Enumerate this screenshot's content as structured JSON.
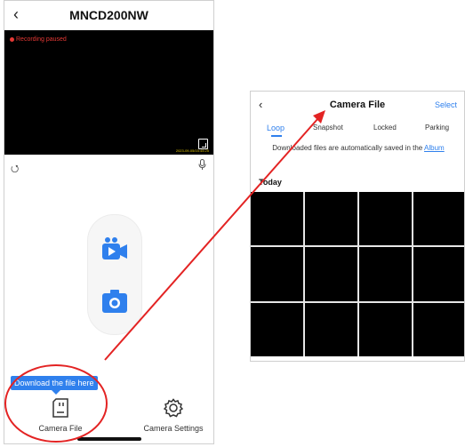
{
  "left_screen": {
    "title": "MNCD200NW",
    "back_icon": "chevron-left-icon",
    "recording_status": "Recording paused",
    "video_timestamp": "2023-09-05/15:45:25",
    "tooltip": "Download the file here",
    "tabs": [
      {
        "label": "Camera File",
        "icon": "sd-card-icon"
      },
      {
        "label": "Camera Settings",
        "icon": "gear-icon"
      }
    ]
  },
  "right_screen": {
    "title": "Camera File",
    "select_label": "Select",
    "tabs": [
      "Loop",
      "Snapshot",
      "Locked",
      "Parking"
    ],
    "active_tab": "Loop",
    "notice_prefix": "Downloaded files are automatically saved in the",
    "notice_link": "Album",
    "section_label": "Today",
    "thumbnail_count": 12
  },
  "colors": {
    "accent": "#2f80ed",
    "annotation_red": "#e32323",
    "recording_red": "#e53935"
  }
}
